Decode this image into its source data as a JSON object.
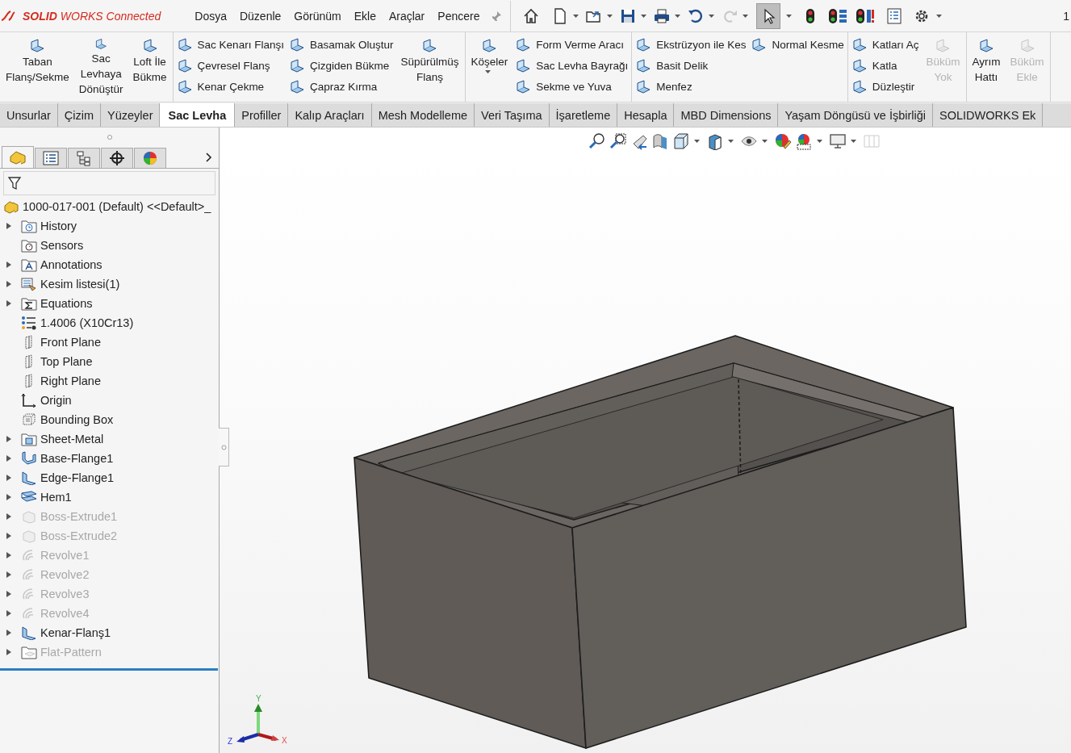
{
  "app_logo": "**SOLID**WORKS Connected",
  "menu": [
    "Dosya",
    "Düzenle",
    "Görünüm",
    "Ekle",
    "Araçlar",
    "Pencere"
  ],
  "quick_toolbar": {
    "pointer_selected": true,
    "redo_disabled": true
  },
  "document_title": "1",
  "ribbon": {
    "groups": [
      {
        "items": [
          {
            "kind": "large",
            "label": "Taban\nFlanş/Sekme",
            "disabled": false
          },
          {
            "kind": "large",
            "label": "Sac\nLevhaya\nDönüştür",
            "disabled": false
          },
          {
            "kind": "large",
            "label": "Loft İle\nBükme",
            "disabled": false
          }
        ]
      },
      {
        "items": [
          {
            "kind": "column",
            "buttons": [
              {
                "label": "Sac Kenarı Flanşı",
                "disabled": false
              },
              {
                "label": "Çevresel Flanş",
                "disabled": false
              },
              {
                "label": "Kenar Çekme",
                "disabled": false
              }
            ]
          },
          {
            "kind": "column",
            "buttons": [
              {
                "label": "Basamak Oluştur",
                "disabled": false
              },
              {
                "label": "Çizgiden Bükme",
                "disabled": false
              },
              {
                "label": "Çapraz Kırma",
                "disabled": false
              }
            ]
          },
          {
            "kind": "large",
            "label": "Süpürülmüş\nFlanş",
            "disabled": false
          }
        ]
      },
      {
        "items": [
          {
            "kind": "large_dropdown",
            "label": "Köşeler",
            "disabled": false
          },
          {
            "kind": "column",
            "buttons": [
              {
                "label": "Form Verme Aracı",
                "disabled": false
              },
              {
                "label": "Sac Levha Bayrağı",
                "disabled": false
              },
              {
                "label": "Sekme ve Yuva",
                "disabled": false
              }
            ]
          }
        ]
      },
      {
        "items": [
          {
            "kind": "column",
            "buttons": [
              {
                "label": "Ekstrüzyon ile Kes",
                "disabled": false
              },
              {
                "label": "Basit Delik",
                "disabled": false
              },
              {
                "label": "Menfez",
                "disabled": false
              }
            ]
          },
          {
            "kind": "column",
            "buttons": [
              {
                "label": "Normal Kesme",
                "disabled": false
              }
            ]
          }
        ]
      },
      {
        "items": [
          {
            "kind": "column",
            "buttons": [
              {
                "label": "Katları Aç",
                "disabled": false
              },
              {
                "label": "Katla",
                "disabled": false
              },
              {
                "label": "Düzleştir",
                "disabled": false
              }
            ]
          },
          {
            "kind": "large",
            "label": "Büküm\nYok",
            "disabled": true
          }
        ]
      },
      {
        "items": [
          {
            "kind": "large",
            "label": "Ayrım\nHattı",
            "disabled": false
          },
          {
            "kind": "large",
            "label": "Büküm\nEkle",
            "disabled": true
          }
        ]
      }
    ]
  },
  "command_tabs": [
    {
      "label": "Unsurlar",
      "selected": false
    },
    {
      "label": "Çizim",
      "selected": false
    },
    {
      "label": "Yüzeyler",
      "selected": false
    },
    {
      "label": "Sac Levha",
      "selected": true
    },
    {
      "label": "Profiller",
      "selected": false
    },
    {
      "label": "Kalıp Araçları",
      "selected": false
    },
    {
      "label": "Mesh Modelleme",
      "selected": false
    },
    {
      "label": "Veri Taşıma",
      "selected": false
    },
    {
      "label": "İşaretleme",
      "selected": false
    },
    {
      "label": "Hesapla",
      "selected": false
    },
    {
      "label": "MBD Dimensions",
      "selected": false
    },
    {
      "label": "Yaşam Döngüsü ve İşbirliği",
      "selected": false
    },
    {
      "label": "SOLIDWORKS Ek",
      "selected": false
    }
  ],
  "feature_manager": {
    "tabs": [
      {
        "kind": "features",
        "selected": true
      },
      {
        "kind": "properties",
        "selected": false
      },
      {
        "kind": "configurations",
        "selected": false
      },
      {
        "kind": "dimxpert",
        "selected": false
      },
      {
        "kind": "display",
        "selected": false
      }
    ],
    "tree": {
      "label": "1000-017-001 (Default) <<Default>_",
      "kind": "part",
      "children": [
        {
          "label": "History",
          "kind": "history",
          "expandable": true,
          "suppressed": false
        },
        {
          "label": "Sensors",
          "kind": "sensors",
          "expandable": false,
          "suppressed": false
        },
        {
          "label": "Annotations",
          "kind": "annotations",
          "expandable": true,
          "suppressed": false
        },
        {
          "label": "Kesim listesi(1)",
          "kind": "cutlist",
          "expandable": true,
          "suppressed": false
        },
        {
          "label": "Equations",
          "kind": "equations",
          "expandable": true,
          "suppressed": false
        },
        {
          "label": "1.4006 (X10Cr13)",
          "kind": "material",
          "expandable": false,
          "suppressed": false
        },
        {
          "label": "Front Plane",
          "kind": "plane",
          "expandable": false,
          "suppressed": false
        },
        {
          "label": "Top Plane",
          "kind": "plane",
          "expandable": false,
          "suppressed": false
        },
        {
          "label": "Right Plane",
          "kind": "plane",
          "expandable": false,
          "suppressed": false
        },
        {
          "label": "Origin",
          "kind": "origin",
          "expandable": false,
          "suppressed": false
        },
        {
          "label": "Bounding Box",
          "kind": "bbox",
          "expandable": false,
          "suppressed": false
        },
        {
          "label": "Sheet-Metal",
          "kind": "sheetmetal",
          "expandable": true,
          "suppressed": false
        },
        {
          "label": "Base-Flange1",
          "kind": "baseflange",
          "expandable": true,
          "suppressed": false
        },
        {
          "label": "Edge-Flange1",
          "kind": "edgeflange",
          "expandable": true,
          "suppressed": false
        },
        {
          "label": "Hem1",
          "kind": "hem",
          "expandable": true,
          "suppressed": false
        },
        {
          "label": "Boss-Extrude1",
          "kind": "extrude",
          "expandable": true,
          "suppressed": true
        },
        {
          "label": "Boss-Extrude2",
          "kind": "extrude",
          "expandable": true,
          "suppressed": true
        },
        {
          "label": "Revolve1",
          "kind": "revolve",
          "expandable": true,
          "suppressed": true
        },
        {
          "label": "Revolve2",
          "kind": "revolve",
          "expandable": true,
          "suppressed": true
        },
        {
          "label": "Revolve3",
          "kind": "revolve",
          "expandable": true,
          "suppressed": true
        },
        {
          "label": "Revolve4",
          "kind": "revolve",
          "expandable": true,
          "suppressed": true
        },
        {
          "label": "Kenar-Flanş1",
          "kind": "edgeflange",
          "expandable": true,
          "suppressed": false
        },
        {
          "label": "Flat-Pattern",
          "kind": "flatpattern",
          "expandable": true,
          "suppressed": true
        }
      ]
    }
  },
  "viewport": {
    "triad": {
      "x": "X",
      "y": "Y",
      "z": "Z"
    }
  }
}
